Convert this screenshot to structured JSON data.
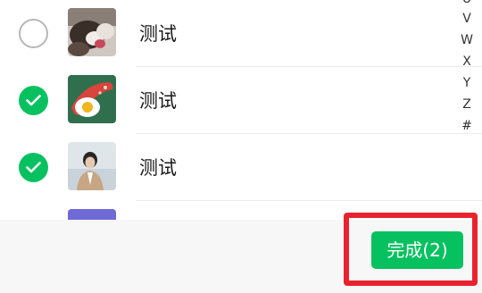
{
  "contacts": [
    {
      "name": "测试",
      "selected": false,
      "avatar": "dog-photo"
    },
    {
      "name": "测试",
      "selected": true,
      "avatar": "fried-egg-sausage-illustration"
    },
    {
      "name": "测试",
      "selected": true,
      "avatar": "person-by-sea-photo"
    },
    {
      "name": "",
      "selected": false,
      "avatar": "purple-avatar"
    }
  ],
  "index_bar": [
    "U",
    "V",
    "W",
    "X",
    "Y",
    "Z",
    "#"
  ],
  "footer": {
    "done_label": "完成(2)"
  },
  "colors": {
    "accent": "#07c160",
    "highlight": "#e8232f"
  },
  "icons": {
    "checked": "checkmark-icon"
  }
}
